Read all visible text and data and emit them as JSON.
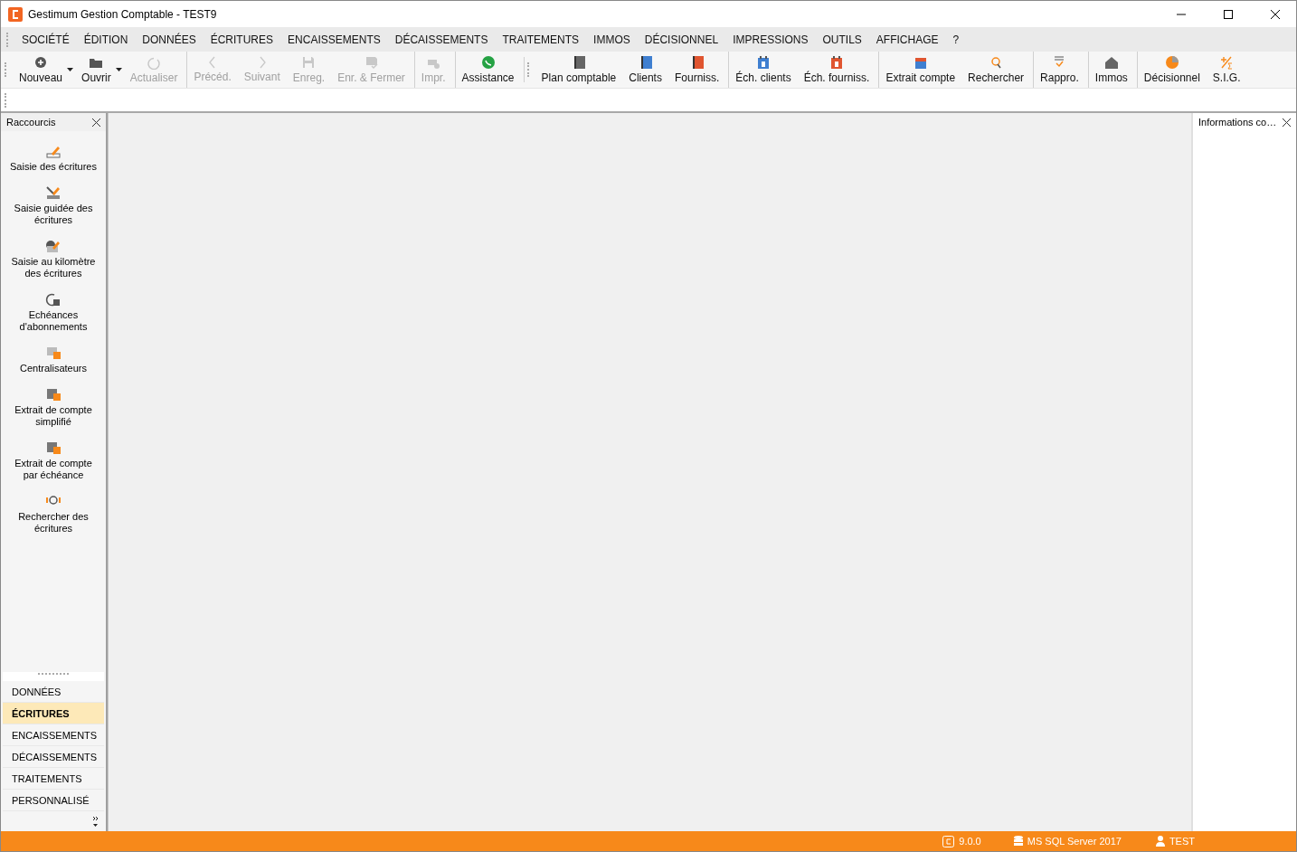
{
  "window": {
    "title": "Gestimum Gestion Comptable - TEST9"
  },
  "menu": [
    "SOCIÉTÉ",
    "ÉDITION",
    "DONNÉES",
    "ÉCRITURES",
    "ENCAISSEMENTS",
    "DÉCAISSEMENTS",
    "TRAITEMENTS",
    "IMMOS",
    "DÉCISIONNEL",
    "IMPRESSIONS",
    "OUTILS",
    "AFFICHAGE",
    "?"
  ],
  "toolbar_left": [
    {
      "label": "Nouveau",
      "disabled": false,
      "dropdown": true,
      "separator_before": false
    },
    {
      "label": "Ouvrir",
      "disabled": false,
      "dropdown": true,
      "separator_before": false
    },
    {
      "label": "Actualiser",
      "disabled": true,
      "dropdown": false,
      "separator_before": false
    },
    {
      "label": "Précéd.",
      "disabled": true,
      "dropdown": false,
      "separator_before": true
    },
    {
      "label": "Suivant",
      "disabled": true,
      "dropdown": false,
      "separator_before": false
    },
    {
      "label": "Enreg.",
      "disabled": true,
      "dropdown": false,
      "separator_before": false
    },
    {
      "label": "Enr. & Fermer",
      "disabled": true,
      "dropdown": false,
      "separator_before": false
    },
    {
      "label": "Impr.",
      "disabled": true,
      "dropdown": false,
      "separator_before": true
    },
    {
      "label": "Assistance",
      "disabled": false,
      "dropdown": false,
      "separator_before": true
    }
  ],
  "toolbar_right": [
    {
      "label": "Plan comptable",
      "separator_before": false
    },
    {
      "label": "Clients",
      "separator_before": false
    },
    {
      "label": "Fourniss.",
      "separator_before": false
    },
    {
      "label": "Éch. clients",
      "separator_before": true
    },
    {
      "label": "Éch. fourniss.",
      "separator_before": false
    },
    {
      "label": "Extrait compte",
      "separator_before": true
    },
    {
      "label": "Rechercher",
      "separator_before": false
    },
    {
      "label": "Rappro.",
      "separator_before": true
    },
    {
      "label": "Immos",
      "separator_before": true
    },
    {
      "label": "Décisionnel",
      "separator_before": true
    },
    {
      "label": "S.I.G.",
      "separator_before": false
    }
  ],
  "shortcuts_panel": {
    "title": "Raccourcis",
    "items": [
      "Saisie des écritures",
      "Saisie guidée des écritures",
      "Saisie au kilomètre des écritures",
      "Echéances d'abonnements",
      "Centralisateurs",
      "Extrait de compte simplifié",
      "Extrait de compte par échéance",
      "Rechercher des écritures"
    ],
    "sections": [
      {
        "label": "DONNÉES",
        "selected": false
      },
      {
        "label": "ÉCRITURES",
        "selected": true
      },
      {
        "label": "ENCAISSEMENTS",
        "selected": false
      },
      {
        "label": "DÉCAISSEMENTS",
        "selected": false
      },
      {
        "label": "TRAITEMENTS",
        "selected": false
      },
      {
        "label": "PERSONNALISÉ",
        "selected": false
      }
    ]
  },
  "info_panel": {
    "title": "Informations co…"
  },
  "status_bar": {
    "version": "9.0.0",
    "database": "MS SQL Server 2017",
    "user": "TEST"
  }
}
